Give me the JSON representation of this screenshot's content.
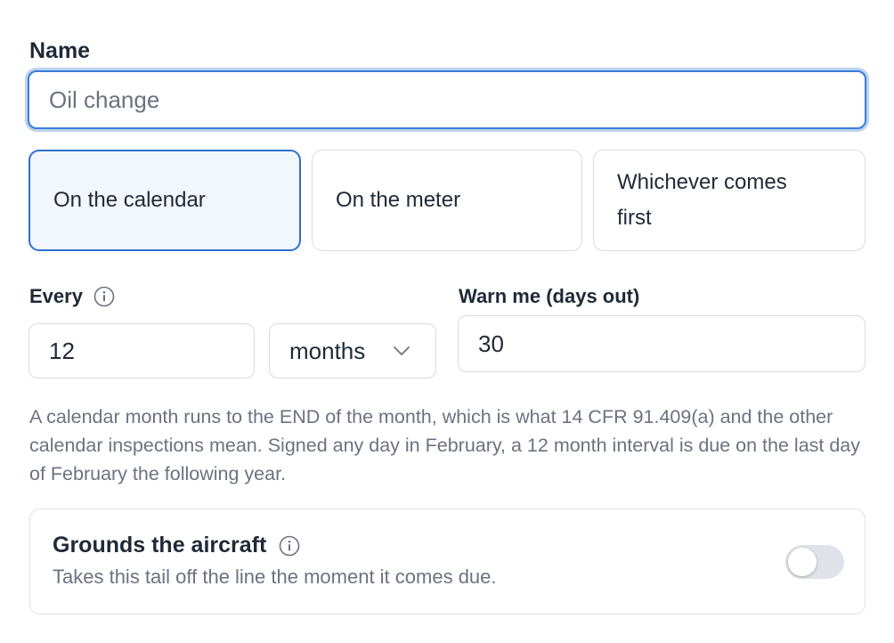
{
  "name_field": {
    "label": "Name",
    "value": "",
    "placeholder": "Oil change"
  },
  "schedule_type": {
    "options": [
      "On the calendar",
      "On the meter",
      "Whichever comes first"
    ],
    "selected": "On the calendar"
  },
  "every": {
    "label": "Every",
    "value": "12",
    "unit": "months",
    "icon": "info-icon"
  },
  "warn": {
    "label": "Warn me (days out)",
    "value": "30"
  },
  "help_text": "A calendar month runs to the END of the month, which is what 14 CFR 91.409(a) and the other calendar inspections mean. Signed any day in February, a 12 month interval is due on the last day of February the following year.",
  "grounds": {
    "title": "Grounds the aircraft",
    "subtitle": "Takes this tail off the line the moment it comes due.",
    "enabled": false,
    "icon": "info-icon"
  },
  "colors": {
    "accent": "#2f6fd0",
    "selected_bg": "#f2f6fd",
    "muted_text": "#6b7280"
  }
}
